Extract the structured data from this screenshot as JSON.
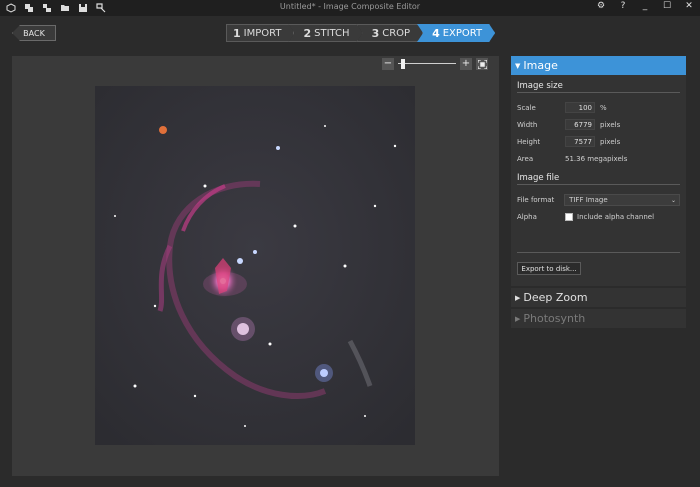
{
  "app": {
    "window_title": "Untitled* - Image Composite Editor",
    "toolbar_icons": [
      "new-project-icon",
      "new-panorama-icon",
      "new-panorama-from-video-icon",
      "open-project-icon",
      "save-project-icon",
      "publish-icon"
    ],
    "window_controls": {
      "settings": "⚙",
      "help": "?",
      "minimize": "_",
      "maximize": "☐",
      "close": "✕"
    }
  },
  "nav": {
    "back_label": "BACK",
    "steps": [
      {
        "num": "1",
        "label": "IMPORT"
      },
      {
        "num": "2",
        "label": "STITCH"
      },
      {
        "num": "3",
        "label": "CROP"
      },
      {
        "num": "4",
        "label": "EXPORT"
      }
    ],
    "active_step": 3
  },
  "canvas": {
    "zoom_minus": "−",
    "zoom_plus": "+",
    "zoom_level": 0.05
  },
  "panel": {
    "image_section": {
      "title": "Image",
      "size_title": "Image size",
      "scale_label": "Scale",
      "scale_value": "100",
      "scale_unit": "%",
      "width_label": "Width",
      "width_value": "6779",
      "width_unit": "pixels",
      "height_label": "Height",
      "height_value": "7577",
      "height_unit": "pixels",
      "area_label": "Area",
      "area_value": "51.36 megapixels",
      "file_title": "Image file",
      "format_label": "File format",
      "format_value": "TIFF Image",
      "alpha_label": "Alpha",
      "alpha_option": "Include alpha channel",
      "export_button": "Export to disk..."
    },
    "deep_zoom_title": "Deep Zoom",
    "photosynth_title": "Photosynth"
  },
  "colors": {
    "accent": "#3d93d8",
    "background": "#2b2b2b"
  }
}
